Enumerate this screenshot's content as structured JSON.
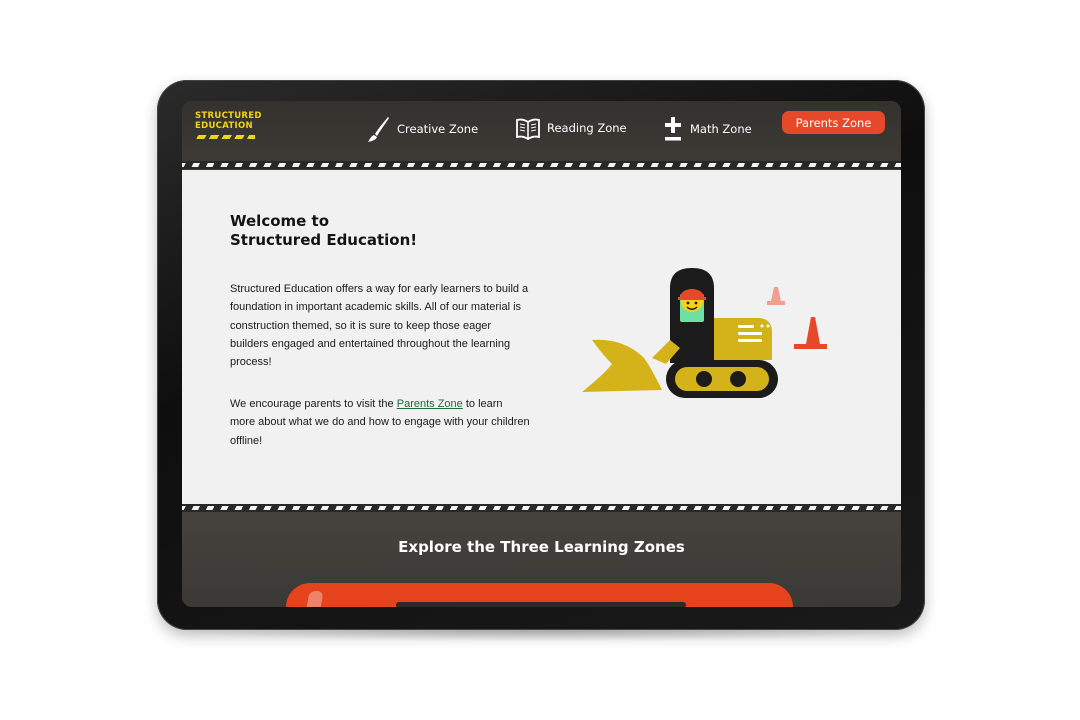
{
  "header": {
    "logo_text": "STRUCTURED\nEDUCATION",
    "nav": [
      {
        "label": "Creative Zone",
        "icon": "paintbrush-icon"
      },
      {
        "label": "Reading Zone",
        "icon": "open-book-icon"
      },
      {
        "label": "Math Zone",
        "icon": "plus-minus-icon"
      }
    ],
    "parents_button": "Parents Zone"
  },
  "main": {
    "title": "Welcome to\nStructured Education!",
    "paragraph1": "Structured Education offers a way for early learners to build a foundation in important academic skills. All of our material is construction themed, so it is sure to keep those eager builders engaged and entertained throughout the learning process!",
    "paragraph2_before": "We encourage parents to visit the ",
    "paragraph2_link": "Parents Zone",
    "paragraph2_after": " to learn more about what we do and how to engage with your children offline!",
    "illustration": "bulldozer-with-smiling-driver-and-traffic-cones"
  },
  "section": {
    "heading": "Explore the Three Learning Zones"
  },
  "colors": {
    "brand_yellow": "#f2d21a",
    "accent_orange": "#e5492a",
    "dark_band": "#3a3833",
    "content_bg": "#f1f1f1",
    "link_green": "#1f6b3a"
  }
}
